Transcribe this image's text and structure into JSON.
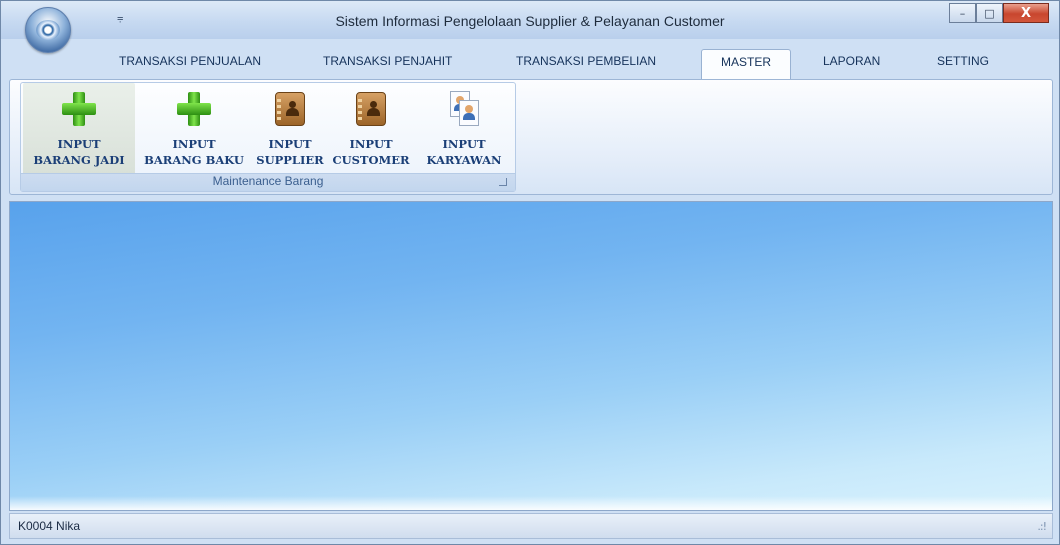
{
  "window": {
    "title": "Sistem Informasi Pengelolaan Supplier & Pelayanan Customer",
    "quick_access_arrow": "⩦",
    "minimize_glyph": "–",
    "maximize_glyph": "□",
    "close_glyph": "X"
  },
  "tabs": [
    {
      "label": "TRANSAKSI PENJUALAN"
    },
    {
      "label": "TRANSAKSI PENJAHIT"
    },
    {
      "label": "TRANSAKSI PEMBELIAN"
    },
    {
      "label": "MASTER",
      "active": true
    },
    {
      "label": "LAPORAN"
    },
    {
      "label": "SETTING"
    }
  ],
  "ribbon": {
    "group_label": "Maintenance Barang",
    "buttons": [
      {
        "line1": "INPUT",
        "line2": "BARANG JADI",
        "icon": "green-plus-icon"
      },
      {
        "line1": "INPUT",
        "line2": "BARANG BAKU",
        "icon": "green-plus-icon"
      },
      {
        "line1": "INPUT",
        "line2": "SUPPLIER",
        "icon": "address-book-icon"
      },
      {
        "line1": "INPUT",
        "line2": "CUSTOMER",
        "icon": "address-book-icon"
      },
      {
        "line1": "INPUT",
        "line2": "KARYAWAN",
        "icon": "employee-cards-icon"
      }
    ]
  },
  "status": {
    "user": "K0004  Nika",
    "grip_glyph": ".:!"
  },
  "colors": {
    "accent": "#1b3f77",
    "workspace_top": "#58a2ec",
    "workspace_bottom": "#d9f2fd"
  }
}
